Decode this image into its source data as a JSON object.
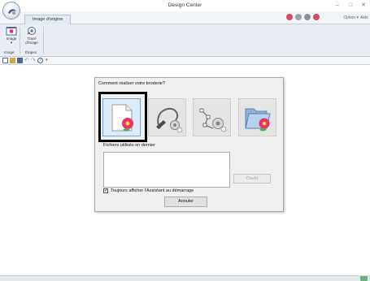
{
  "window": {
    "title": "Design Center",
    "minimize_glyph": "–",
    "maximize_glyph": "□",
    "close_glyph": "✕"
  },
  "tabs": {
    "active": "Image d'origine",
    "option": "Option",
    "option_arrow": "▾",
    "help": "Aide"
  },
  "ribbon": {
    "image_button": "Image",
    "image_arrow": "▾",
    "trace_button_line1": "Tracé",
    "trace_button_line2": "d'image",
    "group_image": "Image",
    "group_steps": "Étapes"
  },
  "dialog": {
    "title": "Comment réaliser votre broderie?",
    "options": [
      {
        "name": "new-from-image",
        "icon": "document-flower-icon"
      },
      {
        "name": "trace-outline",
        "icon": "hand-trace-icon"
      },
      {
        "name": "line-image",
        "icon": "node-gear-icon"
      },
      {
        "name": "open-file",
        "icon": "folder-flower-icon"
      }
    ],
    "recent_label": "Fichiers utilisés en dernier",
    "open_button": "Ouvrir",
    "checkbox_mark": "✓",
    "checkbox_label": "Toujours afficher l'Assistant au démarrage",
    "cancel_button": "Annuler"
  },
  "colors": {
    "accent": "#6aa5d6",
    "selection_frame": "#000000",
    "flower": "#e8326e",
    "leaf": "#53b34a"
  }
}
